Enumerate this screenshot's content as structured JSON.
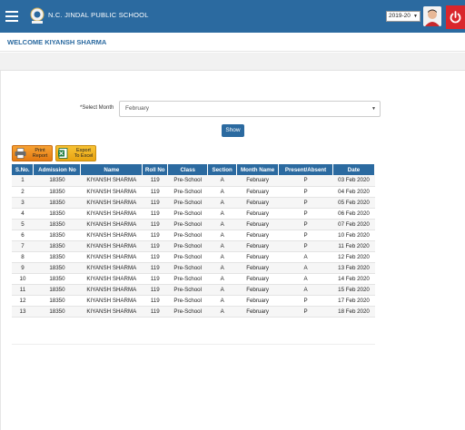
{
  "header": {
    "school_name": "N.C. JINDAL PUBLIC SCHOOL",
    "session_year": "2019-20",
    "bar_color": "#2b6aa0",
    "power_color": "#d9262c"
  },
  "welcome": {
    "text": "WELCOME KIYANSH SHARMA"
  },
  "filters": {
    "month_label": "*Select Month",
    "month_value": "February",
    "show_label": "Show"
  },
  "actions": {
    "print_label_1": "Print",
    "print_label_2": "Report",
    "excel_label_1": "Export",
    "excel_label_2": "To Excel"
  },
  "table": {
    "headers": [
      "S.No.",
      "Admission No",
      "Name",
      "Roll No",
      "Class",
      "Section",
      "Month Name",
      "Present/Absent",
      "Date"
    ],
    "rows": [
      [
        "1",
        "18350",
        "KIYANSH SHARMA",
        "119",
        "Pre-School",
        "A",
        "February",
        "P",
        "03 Feb 2020"
      ],
      [
        "2",
        "18350",
        "KIYANSH SHARMA",
        "119",
        "Pre-School",
        "A",
        "February",
        "P",
        "04 Feb 2020"
      ],
      [
        "3",
        "18350",
        "KIYANSH SHARMA",
        "119",
        "Pre-School",
        "A",
        "February",
        "P",
        "05 Feb 2020"
      ],
      [
        "4",
        "18350",
        "KIYANSH SHARMA",
        "119",
        "Pre-School",
        "A",
        "February",
        "P",
        "06 Feb 2020"
      ],
      [
        "5",
        "18350",
        "KIYANSH SHARMA",
        "119",
        "Pre-School",
        "A",
        "February",
        "P",
        "07 Feb 2020"
      ],
      [
        "6",
        "18350",
        "KIYANSH SHARMA",
        "119",
        "Pre-School",
        "A",
        "February",
        "P",
        "10 Feb 2020"
      ],
      [
        "7",
        "18350",
        "KIYANSH SHARMA",
        "119",
        "Pre-School",
        "A",
        "February",
        "P",
        "11 Feb 2020"
      ],
      [
        "8",
        "18350",
        "KIYANSH SHARMA",
        "119",
        "Pre-School",
        "A",
        "February",
        "A",
        "12 Feb 2020"
      ],
      [
        "9",
        "18350",
        "KIYANSH SHARMA",
        "119",
        "Pre-School",
        "A",
        "February",
        "A",
        "13 Feb 2020"
      ],
      [
        "10",
        "18350",
        "KIYANSH SHARMA",
        "119",
        "Pre-School",
        "A",
        "February",
        "A",
        "14 Feb 2020"
      ],
      [
        "11",
        "18350",
        "KIYANSH SHARMA",
        "119",
        "Pre-School",
        "A",
        "February",
        "A",
        "15 Feb 2020"
      ],
      [
        "12",
        "18350",
        "KIYANSH SHARMA",
        "119",
        "Pre-School",
        "A",
        "February",
        "P",
        "17 Feb 2020"
      ],
      [
        "13",
        "18350",
        "KIYANSH SHARMA",
        "119",
        "Pre-School",
        "A",
        "February",
        "P",
        "18 Feb 2020"
      ]
    ]
  }
}
